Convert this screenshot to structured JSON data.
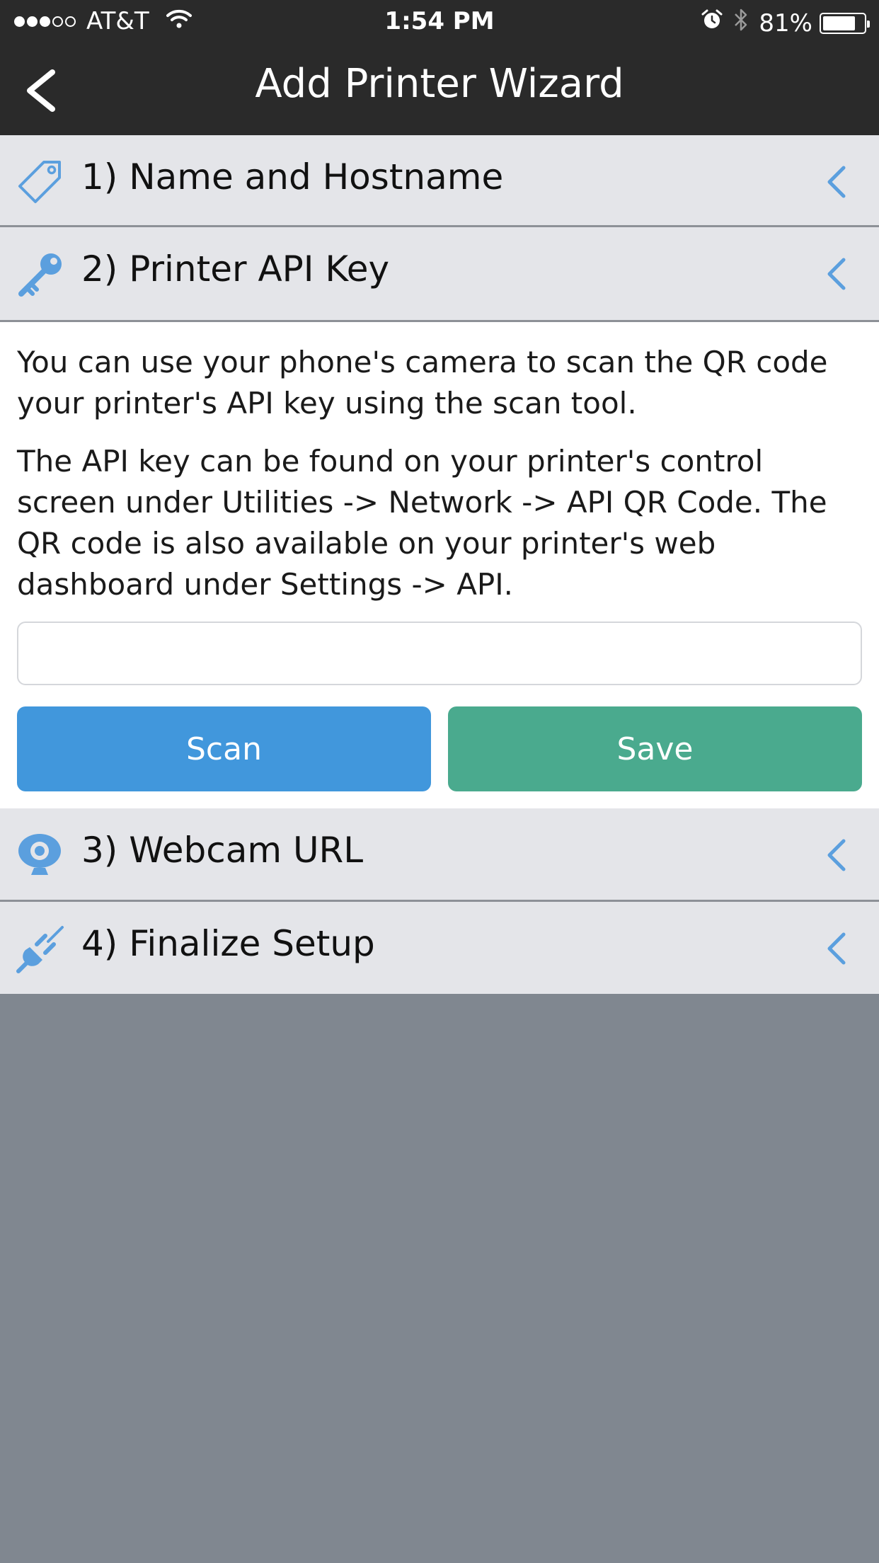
{
  "status_bar": {
    "carrier": "AT&T",
    "signal_full": 3,
    "signal_empty": 2,
    "time": "1:54 PM",
    "battery_percent_text": "81%",
    "battery_level": 0.81
  },
  "nav": {
    "title": "Add Printer Wizard",
    "back_icon": "chevron-left-icon"
  },
  "sections": [
    {
      "label": "1) Name and Hostname",
      "icon": "tag-icon"
    },
    {
      "label": "2) Printer API Key",
      "icon": "key-icon"
    },
    {
      "label": "3) Webcam URL",
      "icon": "webcam-icon"
    },
    {
      "label": "4) Finalize Setup",
      "icon": "plug-icon"
    }
  ],
  "api_key_panel": {
    "intro": "You can use your phone's camera to scan the QR code your printer's API key using the scan tool.",
    "instructions": "The API key can be found on your printer's control screen under Utilities -> Network -> API QR Code.  The QR code is also available on your printer's web dashboard under Settings -> API.",
    "input_value": "",
    "scan_label": "Scan",
    "save_label": "Save"
  },
  "colors": {
    "header_bg": "#2a2a2a",
    "row_bg": "#e4e5e9",
    "accent_blue": "#4197dc",
    "save_green": "#4aaa8e",
    "icon_blue": "#5b9fde",
    "backdrop": "#808790"
  }
}
